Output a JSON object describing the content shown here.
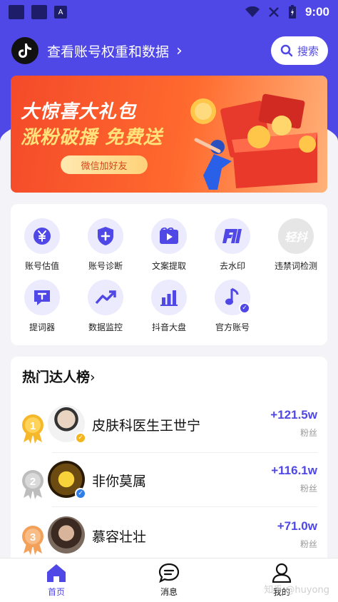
{
  "status_bar": {
    "time": "9:00",
    "badge_a": "A"
  },
  "header": {
    "title": "查看账号权重和数据",
    "chevron": "›",
    "search_label": "搜索"
  },
  "banner": {
    "line1": "大惊喜大礼包",
    "line2": "涨粉破播 免费送",
    "button": "微信加好友"
  },
  "tools": [
    {
      "label": "账号估值",
      "icon": "yen-icon"
    },
    {
      "label": "账号诊断",
      "icon": "shield-plus-icon"
    },
    {
      "label": "文案提取",
      "icon": "video-play-icon"
    },
    {
      "label": "去水印",
      "icon": "watermark-icon"
    },
    {
      "label": "违禁词检测",
      "icon": "forbidden-word-icon",
      "icon_text": "轻抖"
    },
    {
      "label": "提词器",
      "icon": "teleprompter-icon"
    },
    {
      "label": "数据监控",
      "icon": "trend-icon"
    },
    {
      "label": "抖音大盘",
      "icon": "bar-chart-icon"
    },
    {
      "label": "官方账号",
      "icon": "music-note-icon"
    }
  ],
  "ranking": {
    "title": "热门达人榜",
    "chevron": "›",
    "items": [
      {
        "rank": "1",
        "name": "皮肤科医生王世宁",
        "value": "+121.5w",
        "unit": "粉丝",
        "medal_color": "#f5b82a"
      },
      {
        "rank": "2",
        "name": "非你莫属",
        "value": "+116.1w",
        "unit": "粉丝",
        "medal_color": "#bdbdbd"
      },
      {
        "rank": "3",
        "name": "慕容壮壮",
        "value": "+71.0w",
        "unit": "粉丝",
        "medal_color": "#f2a05a"
      }
    ]
  },
  "bottom_nav": [
    {
      "label": "首页",
      "icon": "home-icon",
      "active": true
    },
    {
      "label": "消息",
      "icon": "message-icon",
      "active": false
    },
    {
      "label": "我的",
      "icon": "profile-icon",
      "active": false
    }
  ],
  "watermark": "知乎 @huyong",
  "colors": {
    "accent": "#4f47e6",
    "banner": "#f44a2a"
  }
}
